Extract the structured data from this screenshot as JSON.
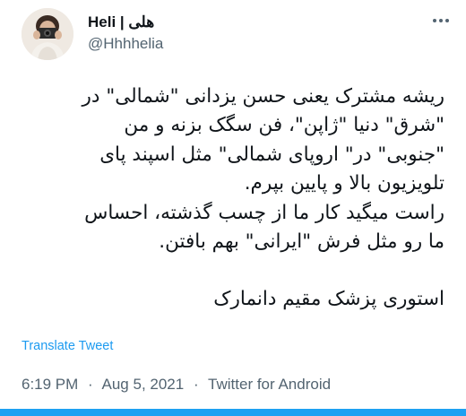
{
  "author": {
    "display_name": "Heli | هلی",
    "handle": "@Hhhhelia"
  },
  "tweet": {
    "text_lines": [
      "ریشه مشترک یعنی حسن یزدانی \"شمالی\" در",
      "\"شرق\" دنیا \"ژاپن\"، فن سگک بزنه و من",
      "\"جنوبی\" در\" اروپای شمالی\" مثل اسپند پای",
      "تلویزیون بالا و پایین بپرم.",
      "راست میگید کار ما از چسب گذشته، احساس",
      "ما رو مثل فرش \"ایرانی\" بهم بافتن."
    ],
    "signature": "استوری پزشک مقیم دانمارک",
    "translate_label": "Translate Tweet"
  },
  "meta": {
    "time": "6:19 PM",
    "date": "Aug 5, 2021",
    "source": "Twitter for Android",
    "separator": "·"
  },
  "colors": {
    "accent": "#1d9bf0",
    "secondary_text": "#536471",
    "primary_text": "#0f1419",
    "bottom_bar": "#1da1f2"
  },
  "icons": {
    "more": "more-horizontal-icon"
  }
}
